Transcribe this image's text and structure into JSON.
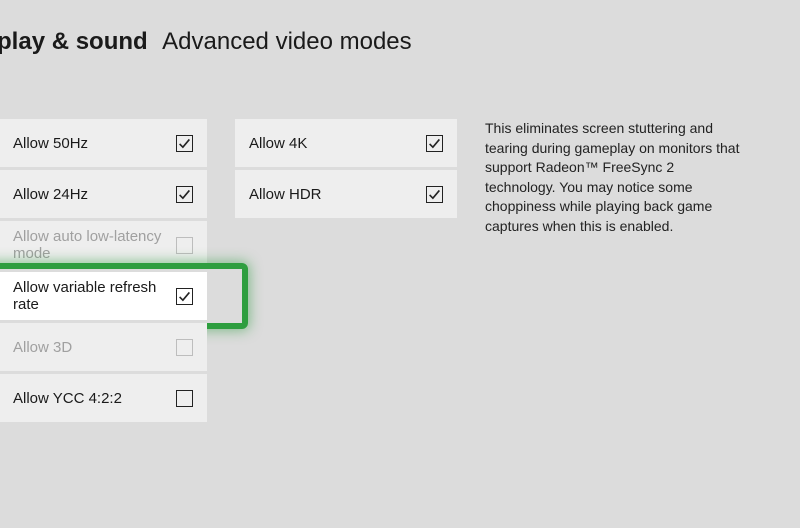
{
  "header": {
    "title": "isplay & sound",
    "subtitle": "Advanced video modes"
  },
  "col1": [
    {
      "label": "Allow 50Hz",
      "checked": true,
      "disabled": false,
      "highlighted": false
    },
    {
      "label": "Allow 24Hz",
      "checked": true,
      "disabled": false,
      "highlighted": false
    },
    {
      "label": "Allow auto low-latency mode",
      "checked": false,
      "disabled": true,
      "highlighted": false
    },
    {
      "label": "Allow variable refresh rate",
      "checked": true,
      "disabled": false,
      "highlighted": true
    },
    {
      "label": "Allow 3D",
      "checked": false,
      "disabled": true,
      "highlighted": false
    },
    {
      "label": "Allow YCC 4:2:2",
      "checked": false,
      "disabled": false,
      "highlighted": false
    }
  ],
  "col2": [
    {
      "label": "Allow 4K",
      "checked": true,
      "disabled": false
    },
    {
      "label": "Allow HDR",
      "checked": true,
      "disabled": false
    }
  ],
  "description": "This eliminates screen stuttering and tearing during gameplay on monitors that support Radeon™ FreeSync 2 technology. You may notice some choppiness while playing back game captures when this is enabled."
}
